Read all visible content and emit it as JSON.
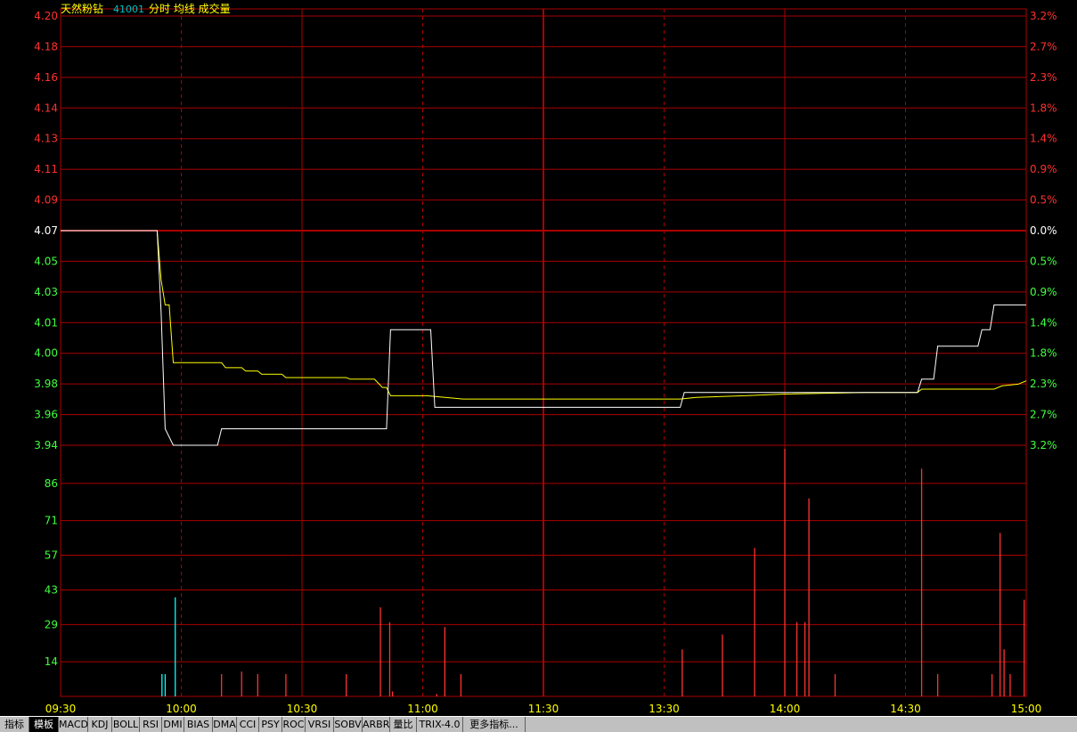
{
  "header": {
    "name": "天然粉钻",
    "code": "41001",
    "mode": "分时 均线 成交量"
  },
  "colors": {
    "background": "#000000",
    "grid": "#aa0000",
    "grid_dash": "#c80000",
    "price_line": "#ffffff",
    "avg_line": "#ffff00",
    "volume_up": "#ff3232",
    "volume_down": "#00ffff",
    "axis_up": "#ff3030",
    "axis_down": "#40ff40",
    "axis_ref": "#ffffff",
    "time_text": "#ffff00"
  },
  "toolbar": {
    "selected_index": 1,
    "items": [
      "指标",
      "模板",
      "MACD",
      "KDJ",
      "BOLL",
      "RSI",
      "DMI",
      "BIAS",
      "DMA",
      "CCI",
      "PSY",
      "ROC",
      "VRSI",
      "SOBV",
      "ARBR",
      "量比",
      "TRIX-4.0",
      "更多指标..."
    ]
  },
  "chart_data": {
    "type": "line",
    "reference_price": 4.07,
    "price_axis": {
      "ylim": [
        3.94,
        4.2
      ],
      "left_ticks": [
        "4.20",
        "4.18",
        "4.16",
        "4.14",
        "4.13",
        "4.11",
        "4.09",
        "4.07",
        "4.05",
        "4.03",
        "4.01",
        "4.00",
        "3.98",
        "3.96",
        "3.94"
      ],
      "right_ticks": [
        "3.2%",
        "2.7%",
        "2.3%",
        "1.8%",
        "1.4%",
        "0.9%",
        "0.5%",
        "0.0%",
        "0.5%",
        "0.9%",
        "1.4%",
        "1.8%",
        "2.3%",
        "2.7%",
        "3.2%"
      ]
    },
    "volume_axis": {
      "ylim": [
        0,
        100
      ],
      "ticks": [
        "86",
        "71",
        "57",
        "43",
        "29",
        "14"
      ],
      "tick_values": [
        86,
        71,
        57,
        43,
        29,
        14
      ]
    },
    "x_axis": {
      "ticks": [
        "09:30",
        "10:00",
        "10:30",
        "11:00",
        "11:30",
        "13:30",
        "14:00",
        "14:30",
        "15:00"
      ],
      "tick_minutes": [
        0,
        30,
        60,
        90,
        120,
        150,
        180,
        210,
        240
      ]
    },
    "series": [
      {
        "key": "price",
        "points": [
          [
            0,
            4.07
          ],
          [
            24,
            4.07
          ],
          [
            25,
            4.02
          ],
          [
            26,
            3.95
          ],
          [
            28,
            3.94
          ],
          [
            39,
            3.94
          ],
          [
            40,
            3.95
          ],
          [
            81,
            3.95
          ],
          [
            82,
            4.01
          ],
          [
            92,
            4.01
          ],
          [
            93,
            3.963
          ],
          [
            154,
            3.963
          ],
          [
            155,
            3.972
          ],
          [
            213,
            3.972
          ],
          [
            214,
            3.98
          ],
          [
            217,
            3.98
          ],
          [
            218,
            4.0
          ],
          [
            228,
            4.0
          ],
          [
            229,
            4.01
          ],
          [
            231,
            4.01
          ],
          [
            232,
            4.025
          ],
          [
            240,
            4.025
          ]
        ]
      },
      {
        "key": "avg",
        "points": [
          [
            0,
            4.07
          ],
          [
            24,
            4.07
          ],
          [
            25,
            4.04
          ],
          [
            26,
            4.025
          ],
          [
            27,
            4.025
          ],
          [
            28,
            3.99
          ],
          [
            40,
            3.99
          ],
          [
            41,
            3.987
          ],
          [
            45,
            3.987
          ],
          [
            46,
            3.985
          ],
          [
            49,
            3.985
          ],
          [
            50,
            3.983
          ],
          [
            55,
            3.983
          ],
          [
            56,
            3.981
          ],
          [
            71,
            3.981
          ],
          [
            72,
            3.98
          ],
          [
            78,
            3.98
          ],
          [
            80,
            3.975
          ],
          [
            81,
            3.975
          ],
          [
            82,
            3.97
          ],
          [
            91,
            3.97
          ],
          [
            100,
            3.968
          ],
          [
            154,
            3.968
          ],
          [
            158,
            3.969
          ],
          [
            170,
            3.97
          ],
          [
            180,
            3.971
          ],
          [
            200,
            3.972
          ],
          [
            213,
            3.972
          ],
          [
            214,
            3.974
          ],
          [
            232,
            3.974
          ],
          [
            234,
            3.976
          ],
          [
            238,
            3.977
          ],
          [
            240,
            3.979
          ]
        ]
      }
    ],
    "volume": [
      {
        "m": 25.2,
        "v": 9,
        "dir": "down"
      },
      {
        "m": 26,
        "v": 9,
        "dir": "down"
      },
      {
        "m": 28.5,
        "v": 40,
        "dir": "down"
      },
      {
        "m": 40,
        "v": 9,
        "dir": "up"
      },
      {
        "m": 45,
        "v": 10,
        "dir": "up"
      },
      {
        "m": 49,
        "v": 9,
        "dir": "up"
      },
      {
        "m": 56,
        "v": 9,
        "dir": "up"
      },
      {
        "m": 71,
        "v": 9,
        "dir": "up"
      },
      {
        "m": 79.5,
        "v": 36,
        "dir": "up"
      },
      {
        "m": 81.8,
        "v": 30,
        "dir": "up"
      },
      {
        "m": 82.5,
        "v": 2,
        "dir": "up"
      },
      {
        "m": 93.5,
        "v": 1,
        "dir": "up"
      },
      {
        "m": 95.5,
        "v": 28,
        "dir": "up"
      },
      {
        "m": 99.5,
        "v": 9,
        "dir": "up"
      },
      {
        "m": 154.5,
        "v": 19,
        "dir": "up"
      },
      {
        "m": 164.5,
        "v": 25,
        "dir": "up"
      },
      {
        "m": 172.5,
        "v": 60,
        "dir": "up"
      },
      {
        "m": 180,
        "v": 100,
        "dir": "up"
      },
      {
        "m": 183,
        "v": 30,
        "dir": "up"
      },
      {
        "m": 185,
        "v": 30,
        "dir": "up"
      },
      {
        "m": 186,
        "v": 80,
        "dir": "up"
      },
      {
        "m": 192.5,
        "v": 9,
        "dir": "up"
      },
      {
        "m": 214,
        "v": 92,
        "dir": "up"
      },
      {
        "m": 218,
        "v": 9,
        "dir": "up"
      },
      {
        "m": 231.5,
        "v": 9,
        "dir": "up"
      },
      {
        "m": 233.5,
        "v": 66,
        "dir": "up"
      },
      {
        "m": 234.5,
        "v": 19,
        "dir": "up"
      },
      {
        "m": 236,
        "v": 9,
        "dir": "up"
      },
      {
        "m": 239.5,
        "v": 39,
        "dir": "up"
      }
    ]
  }
}
